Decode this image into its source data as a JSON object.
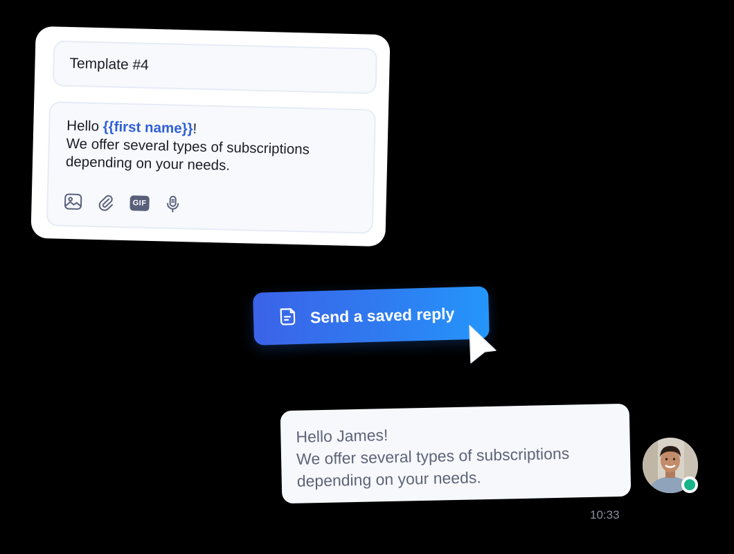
{
  "template_card": {
    "name": "Template #4",
    "body": {
      "greeting": "Hello ",
      "variable": "{{first name}}",
      "greeting_end": "!",
      "line2": "We offer several types of subscriptions",
      "line3": "depending on your needs."
    },
    "toolbar": {
      "gif_label": "GIF",
      "icons": [
        "image-icon",
        "attachment-icon",
        "gif-icon",
        "microphone-icon"
      ]
    }
  },
  "send_button": {
    "label": "Send a saved reply",
    "icon": "note-icon"
  },
  "message": {
    "line1": "Hello James!",
    "line2": "We offer several types of subscriptions",
    "line3": "depending on your needs.",
    "time": "10:33"
  },
  "avatar": {
    "status": "online",
    "status_color": "#16b489"
  },
  "colors": {
    "accent": "#2f5fd6",
    "button_start": "#3b63e8",
    "button_end": "#2496fb",
    "background": "#000000"
  }
}
